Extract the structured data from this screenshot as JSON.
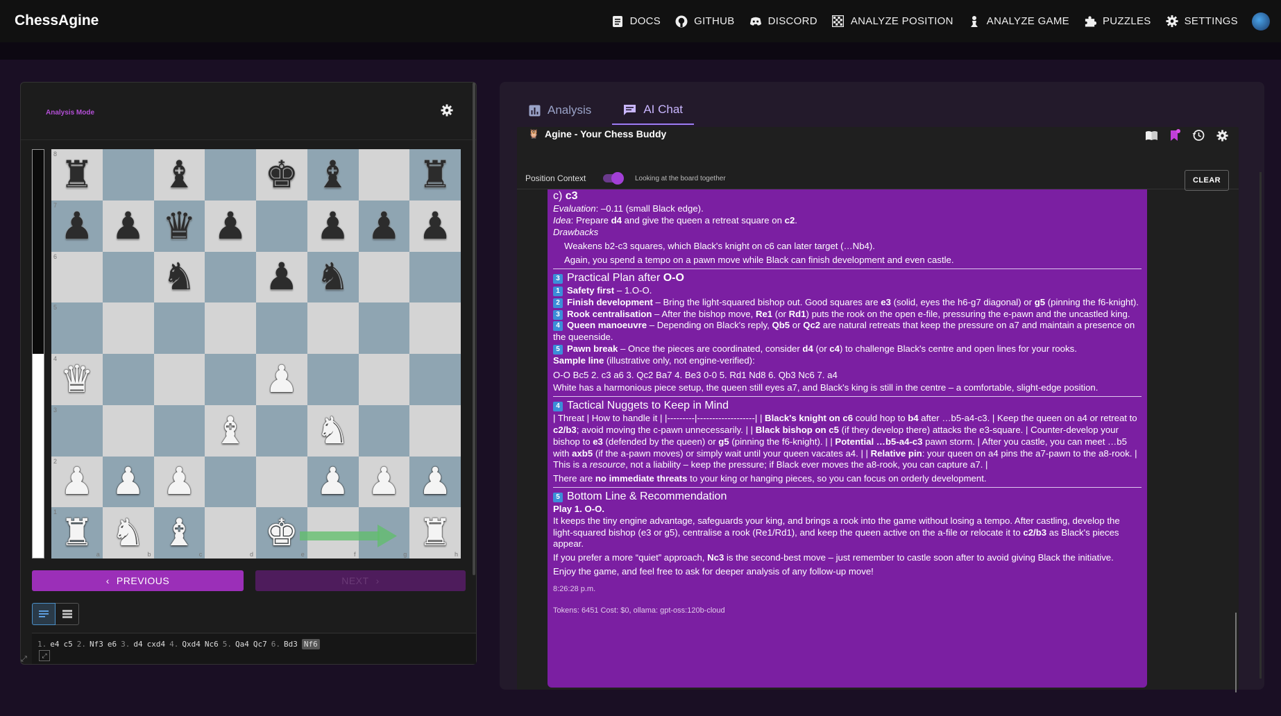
{
  "app": {
    "brand": "ChessAgine"
  },
  "nav": [
    {
      "label": "DOCS",
      "icon": "docs-icon"
    },
    {
      "label": "GITHUB",
      "icon": "github-icon"
    },
    {
      "label": "DISCORD",
      "icon": "discord-icon"
    },
    {
      "label": "ANALYZE POSITION",
      "icon": "board-icon"
    },
    {
      "label": "ANALYZE GAME",
      "icon": "pawn-icon"
    },
    {
      "label": "PUZZLES",
      "icon": "puzzle-icon"
    },
    {
      "label": "SETTINGS",
      "icon": "gear-icon"
    }
  ],
  "board_panel": {
    "mode_label": "Analysis Mode",
    "eval_black_fraction": 0.5,
    "prev_label": "PREVIOUS",
    "next_label": "NEXT",
    "ranks": [
      "8",
      "7",
      "6",
      "5",
      "4",
      "3",
      "2",
      "1"
    ],
    "files": [
      "a",
      "b",
      "c",
      "d",
      "e",
      "f",
      "g",
      "h"
    ],
    "position": [
      [
        "br",
        "",
        "bb",
        "",
        "bk",
        "bb",
        "",
        "br"
      ],
      [
        "bp",
        "bp",
        "bq",
        "bp",
        "",
        "bp",
        "bp",
        "bp"
      ],
      [
        "",
        "",
        "bn",
        "",
        "bp",
        "bn",
        "",
        ""
      ],
      [
        "",
        "",
        "",
        "",
        "",
        "",
        "",
        ""
      ],
      [
        "wq",
        "",
        "",
        "",
        "wp",
        "",
        "",
        ""
      ],
      [
        "",
        "",
        "",
        "wb",
        "",
        "wn",
        "",
        ""
      ],
      [
        "wp",
        "wp",
        "wp",
        "",
        "",
        "wp",
        "wp",
        "wp"
      ],
      [
        "wr",
        "wn",
        "wb",
        "",
        "wk",
        "",
        "",
        "wr"
      ]
    ],
    "arrow": {
      "from": "e1",
      "to": "g1"
    },
    "moves": [
      {
        "num": "1.",
        "white": "e4",
        "black": "c5"
      },
      {
        "num": "2.",
        "white": "Nf3",
        "black": "e6"
      },
      {
        "num": "3.",
        "white": "d4",
        "black": "cxd4"
      },
      {
        "num": "4.",
        "white": "Qxd4",
        "black": "Nc6"
      },
      {
        "num": "5.",
        "white": "Qa4",
        "black": "Qc7"
      },
      {
        "num": "6.",
        "white": "Bd3",
        "black": "Nf6"
      }
    ],
    "current_move": "Nf6"
  },
  "right_panel": {
    "tabs": [
      {
        "label": "Analysis",
        "icon": "chart-icon",
        "active": false
      },
      {
        "label": "AI Chat",
        "icon": "chat-icon",
        "active": true
      }
    ],
    "chat_title": "Agine - Your Chess Buddy",
    "context_label": "Position Context",
    "context_on": true,
    "context_hint": "Looking at the board together",
    "clear_label": "CLEAR",
    "message": {
      "c3_head": "c) ",
      "c3_move": "c3",
      "eval_label": "Evaluation",
      "eval_text": ": –0.11 (small Black edge).",
      "idea_label": "Idea",
      "idea_a": ": Prepare ",
      "idea_b": "d4",
      "idea_c": " and give the queen a retreat square on ",
      "idea_d": "c2",
      "idea_e": ".",
      "drawbacks_label": "Drawbacks",
      "drawback_1": "Weakens b2-c3 squares, which Black's knight on c6 can later target (…Nb4).",
      "drawback_2": "Again, you spend a tempo on a pawn move while Black can finish development and even castle.",
      "s3_num": "3",
      "s3_title_a": "Practical Plan after ",
      "s3_title_b": "O-O",
      "p1_num": "1",
      "p1_b": "Safety first",
      "p1_t": " – 1.O-O.",
      "p2_num": "2",
      "p2_b": "Finish development",
      "p2_t1": " – Bring the light-squared bishop out. Good squares are ",
      "p2_e3": "e3",
      "p2_t2": " (solid, eyes the h6-g7 diagonal) or ",
      "p2_g5": "g5",
      "p2_t3": " (pinning the f6-knight).",
      "p3_num": "3",
      "p3_b": "Rook centralisation",
      "p3_t1": " – After the bishop move, ",
      "p3_re1": "Re1",
      "p3_t2": " (or ",
      "p3_rd1": "Rd1",
      "p3_t3": ") puts the rook on the open e-file, pressuring the e-pawn and the uncastled king.",
      "p4_num": "4",
      "p4_b": "Queen manoeuvre",
      "p4_t1": " – Depending on Black's reply, ",
      "p4_qb5": "Qb5",
      "p4_t2": " or ",
      "p4_qc2": "Qc2",
      "p4_t3": " are natural retreats that keep the pressure on a7 and maintain a presence on the queenside.",
      "p5_num": "5",
      "p5_b": "Pawn break",
      "p5_t1": " – Once the pieces are coordinated, consider ",
      "p5_d4": "d4",
      "p5_t2": " (or ",
      "p5_c4": "c4",
      "p5_t3": ") to challenge Black's centre and open lines for your rooks.",
      "sample_b": "Sample line",
      "sample_t": " (illustrative only, not engine-verified):",
      "sample_line": "O-O Bc5 2. c3 a6 3. Qc2 Ba7 4. Be3 0-0 5. Rd1 Nd8 6. Qb3 Nc6 7. a4",
      "sample_summary": "White has a harmonious piece setup, the queen still eyes a7, and Black's king is still in the centre – a comfortable, slight-edge position.",
      "s4_num": "4",
      "s4_title": "Tactical Nuggets to Keep in Mind",
      "t_a": "| Threat | How to handle it | |---------|-------------------| | ",
      "t_b": "Black's knight on c6",
      "t_c": " could hop to ",
      "t_d": "b4",
      "t_e": " after …b5-a4-c3. | Keep the queen on a4 or retreat to ",
      "t_f": "c2/b3",
      "t_g": "; avoid moving the c-pawn unnecessarily. | | ",
      "t_h": "Black bishop on c5",
      "t_i": " (if they develop there) attacks the e3-square. | Counter-develop your bishop to ",
      "t_j": "e3",
      "t_k": " (defended by the queen) or ",
      "t_l": "g5",
      "t_m": " (pinning the f6-knight). | | ",
      "t_n": "Potential …b5-a4-c3",
      "t_o": " pawn storm. | After you castle, you can meet …b5 with ",
      "t_p": "axb5",
      "t_q": " (if the a-pawn moves) or simply wait until your queen vacates a4. | | ",
      "t_r": "Relative pin",
      "t_s": ": your queen on a4 pins the a7-pawn to the a8-rook. | This is a ",
      "t_t": "resource",
      "t_u": ", not a liability – keep the pressure; if Black ever moves the a8-rook, you can capture a7. |",
      "no_threat_a": "There are ",
      "no_threat_b": "no immediate threats",
      "no_threat_c": " to your king or hanging pieces, so you can focus on orderly development.",
      "s5_num": "5",
      "s5_title": "Bottom Line & Recommendation",
      "play_b": "Play 1. O-O.",
      "rec_a": "It keeps the tiny engine advantage, safeguards your king, and brings a rook into the game without losing a tempo. After castling, develop the light-squared bishop (e3 or g5), centralise a rook (Re1/Rd1), and keep the queen active on the a-file or relocate it to ",
      "rec_b": "c2/b3",
      "rec_c": " as Black's pieces appear.",
      "quiet_a": "If you prefer a more “quiet” approach, ",
      "quiet_b": "Nc3",
      "quiet_c": " is the second-best move – just remember to castle soon after to avoid giving Black the initiative.",
      "enjoy": "Enjoy the game, and feel free to ask for deeper analysis of any follow-up move!",
      "time": "8:26:28 p.m.",
      "tokens": "Tokens: 6451 Cost: $0, ollama: gpt-oss:120b-cloud"
    }
  }
}
